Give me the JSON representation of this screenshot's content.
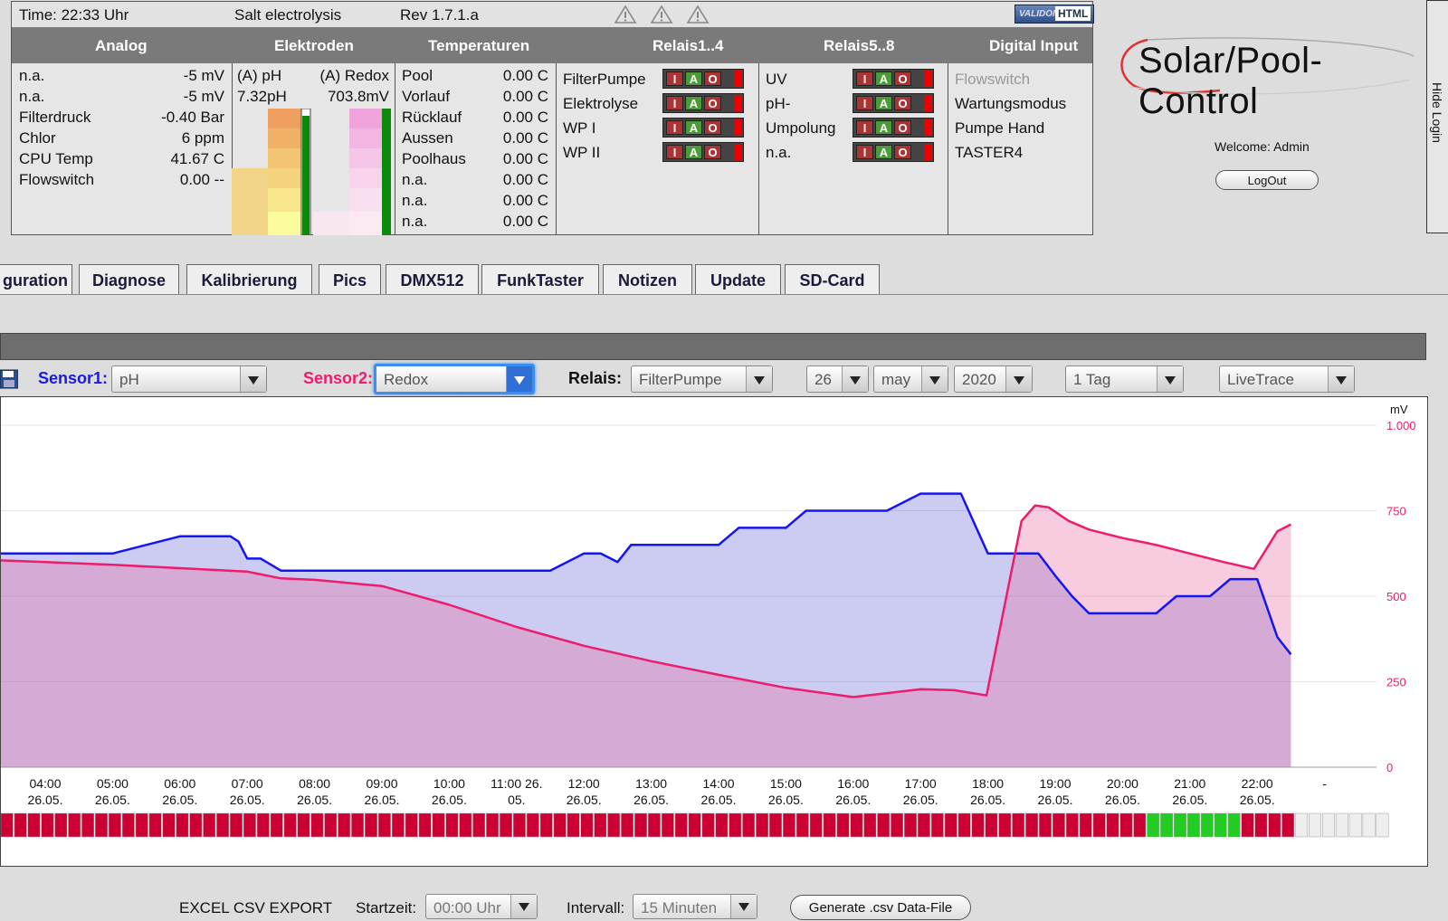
{
  "status": {
    "time": "Time: 22:33 Uhr",
    "mode": "Salt electrolysis",
    "rev": "Rev 1.7.1.a",
    "validator": {
      "left": "VALIDOME",
      "right": "HTML"
    },
    "headers": [
      "Analog",
      "Elektroden",
      "Temperaturen",
      "Relais1..4",
      "Relais5..8",
      "Digital Input"
    ],
    "analog": [
      {
        "k": "n.a.",
        "v": "-5 mV"
      },
      {
        "k": "n.a.",
        "v": "-5 mV"
      },
      {
        "k": "Filterdruck",
        "v": "-0.40 Bar"
      },
      {
        "k": "Chlor",
        "v": "6 ppm"
      },
      {
        "k": "CPU Temp",
        "v": "41.67 C"
      },
      {
        "k": "Flowswitch",
        "v": "0.00 --"
      }
    ],
    "electrodes": {
      "ph_label": "(A) pH",
      "redox_label": "(A) Redox",
      "ph_value": "7.32pH",
      "redox_value": "703.8mV"
    },
    "temperatures": [
      {
        "k": "Pool",
        "v": "0.00 C"
      },
      {
        "k": "Vorlauf",
        "v": "0.00 C"
      },
      {
        "k": "Rücklauf",
        "v": "0.00 C"
      },
      {
        "k": "Aussen",
        "v": "0.00 C"
      },
      {
        "k": "Poolhaus",
        "v": "0.00 C"
      },
      {
        "k": "n.a.",
        "v": "0.00 C"
      },
      {
        "k": "n.a.",
        "v": "0.00 C"
      },
      {
        "k": "n.a.",
        "v": "0.00 C"
      }
    ],
    "relais1_4": [
      "FilterPumpe",
      "Elektrolyse",
      "WP I",
      "WP II"
    ],
    "relais5_8": [
      "UV",
      "pH-",
      "Umpolung",
      "n.a."
    ],
    "relay_buttons": {
      "i": "I",
      "a": "A",
      "o": "O"
    },
    "digital_inputs": [
      "Flowswitch",
      "Wartungsmodus",
      "Pumpe Hand",
      "TASTER4"
    ]
  },
  "logo": "Solar/Pool-Control",
  "welcome": "Welcome:  Admin",
  "logout": "LogOut",
  "hide_login": "Hide Login",
  "tabs": [
    "guration",
    "Diagnose",
    "Kalibrierung",
    "Pics",
    "DMX512",
    "FunkTaster",
    "Notizen",
    "Update",
    "SD-Card"
  ],
  "controls": {
    "sensor1_label": "Sensor1:",
    "sensor1_value": "pH",
    "sensor2_label": "Sensor2:",
    "sensor2_value": "Redox",
    "relais_label": "Relais:",
    "relais_value": "FilterPumpe",
    "day": "26",
    "month": "may",
    "year": "2020",
    "range": "1 Tag",
    "mode": "LiveTrace"
  },
  "colors": {
    "sensor1": "#1515f0",
    "sensor2": "#ee1c6c",
    "relay_on": "#22cc22",
    "relay_off": "#cc0033"
  },
  "chart_data": {
    "type": "area",
    "y_unit": "mV",
    "y_ticks": [
      "0",
      "250",
      "500",
      "750",
      "1.000"
    ],
    "ylim": [
      0,
      1000
    ],
    "x_ticks": [
      [
        "04:00",
        "26.05."
      ],
      [
        "05:00",
        "26.05."
      ],
      [
        "06:00",
        "26.05."
      ],
      [
        "07:00",
        "26.05."
      ],
      [
        "08:00",
        "26.05."
      ],
      [
        "09:00",
        "26.05."
      ],
      [
        "10:00",
        "26.05."
      ],
      [
        "11:00 26.",
        "05."
      ],
      [
        "12:00",
        "26.05."
      ],
      [
        "13:00",
        "26.05."
      ],
      [
        "14:00",
        "26.05."
      ],
      [
        "15:00",
        "26.05."
      ],
      [
        "16:00",
        "26.05."
      ],
      [
        "17:00",
        "26.05."
      ],
      [
        "18:00",
        "26.05."
      ],
      [
        "19:00",
        "26.05."
      ],
      [
        "20:00",
        "26.05."
      ],
      [
        "21:00",
        "26.05."
      ],
      [
        "22:00",
        "26.05."
      ],
      [
        "-",
        ""
      ]
    ],
    "series": [
      {
        "color": "#1515f0",
        "x": [
          3.3,
          4.2,
          4.75,
          5.0,
          6.0,
          6.6,
          6.75,
          6.87,
          7.0,
          7.2,
          7.5,
          8.0,
          8.5,
          9.0,
          9.25,
          9.5,
          10.0,
          10.5,
          11.0,
          11.5,
          12.0,
          12.25,
          12.5,
          12.7,
          13.0,
          13.5,
          14.0,
          14.3,
          14.6,
          15.0,
          15.3,
          15.55,
          15.7,
          16.0,
          16.5,
          17.0,
          17.3,
          17.6,
          18.0,
          18.5,
          18.75,
          19.0,
          19.25,
          19.5,
          20.0,
          20.5,
          20.8,
          20.95,
          21.3,
          21.6,
          22.0,
          22.3,
          22.5
        ],
        "y": [
          625,
          625,
          625,
          625,
          675,
          675,
          675,
          660,
          610,
          610,
          575,
          575,
          575,
          575,
          575,
          575,
          575,
          575,
          575,
          575,
          625,
          625,
          600,
          650,
          650,
          650,
          650,
          700,
          700,
          700,
          750,
          750,
          750,
          750,
          750,
          800,
          800,
          800,
          625,
          625,
          625,
          560,
          500,
          450,
          450,
          450,
          500,
          500,
          500,
          550,
          550,
          380,
          330
        ]
      },
      {
        "color": "#ee1c6c",
        "x": [
          3.3,
          4.0,
          5.0,
          6.0,
          7.0,
          7.5,
          8.0,
          9.0,
          10.0,
          11.0,
          12.0,
          13.0,
          14.0,
          15.0,
          16.0,
          17.0,
          17.5,
          17.98,
          18.5,
          18.7,
          18.9,
          19.2,
          19.5,
          20.0,
          20.5,
          21.0,
          21.5,
          21.95,
          22.3,
          22.5
        ],
        "y": [
          605,
          600,
          592,
          582,
          572,
          552,
          548,
          530,
          475,
          410,
          355,
          310,
          270,
          232,
          205,
          228,
          225,
          210,
          720,
          765,
          760,
          720,
          695,
          670,
          650,
          625,
          600,
          580,
          690,
          710
        ]
      }
    ],
    "x_range_hours": [
      3.3,
      22.5
    ],
    "relay_timeline": {
      "label": "FilterPumpe",
      "on_from_hour": 20.3,
      "on_to_hour": 21.8,
      "data_until_hour": 22.5
    }
  },
  "export": {
    "title": "EXCEL CSV EXPORT",
    "start_label": "Startzeit:",
    "start_value": "00:00 Uhr",
    "interval_label": "Intervall:",
    "interval_value": "15 Minuten",
    "generate": "Generate .csv Data-File"
  }
}
